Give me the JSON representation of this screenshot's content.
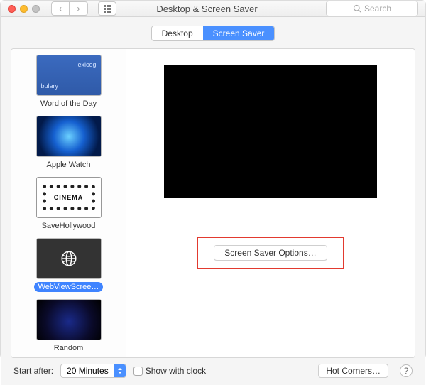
{
  "window": {
    "title": "Desktop & Screen Saver"
  },
  "search": {
    "placeholder": "Search"
  },
  "tabs": {
    "desktop": "Desktop",
    "screensaver": "Screen Saver"
  },
  "sidebar": {
    "items": [
      {
        "label": "Word of the Day"
      },
      {
        "label": "Apple Watch"
      },
      {
        "label": "SaveHollywood",
        "ticket": "CINEMA"
      },
      {
        "label": "WebViewScree…"
      },
      {
        "label": "Random"
      }
    ]
  },
  "main": {
    "options_button": "Screen Saver Options…"
  },
  "footer": {
    "start_after_label": "Start after:",
    "start_after_value": "20 Minutes",
    "show_with_clock": "Show with clock",
    "hot_corners": "Hot Corners…",
    "help": "?"
  },
  "icons": {
    "back": "‹",
    "forward": "›"
  }
}
